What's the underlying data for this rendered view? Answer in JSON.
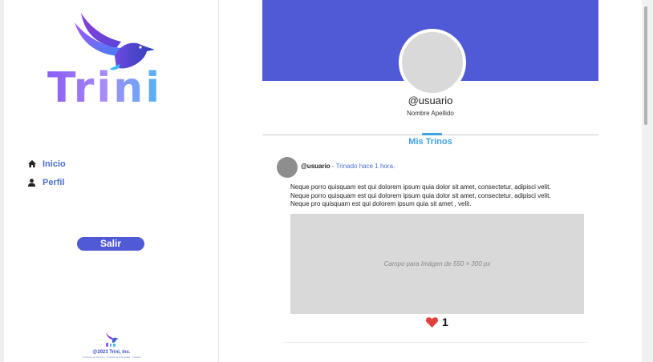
{
  "brand": {
    "name": "Trini",
    "icon": "bird-icon",
    "gradient": [
      "#8b5cf6",
      "#38bdf8"
    ]
  },
  "nav": {
    "items": [
      {
        "label": "Inicio",
        "icon": "home-icon"
      },
      {
        "label": "Perfil",
        "icon": "user-icon"
      }
    ]
  },
  "logout_label": "Salir",
  "footer": {
    "copyright": "@2023 Trini, Inc.",
    "links": "Términos de Servicio · Política de Privacidad · Cookies"
  },
  "profile": {
    "username": "@usuario",
    "fullname": "Nombre Apellido",
    "tab": "Mis Trinos"
  },
  "post": {
    "username": "@usuario",
    "separator": " - ",
    "timestamp": "Trinado hace 1 hora.",
    "lines": [
      "Neque porro quisquam est qui dolorem ipsum quia dolor sit amet, consectetur, adipisci velit.",
      "Neque porro quisquam est qui dolorem ipsum quia dolor sit amet, consectetur, adipisci velit.",
      "Neque pro quisquam est qui dolorem ipsum quia sit amet , velit."
    ],
    "image_placeholder": "Campo para Imágen de 550 × 300 px",
    "likes": "1"
  },
  "colors": {
    "accent": "#5059d6",
    "tab": "#3fa2df",
    "link": "#4a6fd1",
    "heart": "#e0413b"
  }
}
